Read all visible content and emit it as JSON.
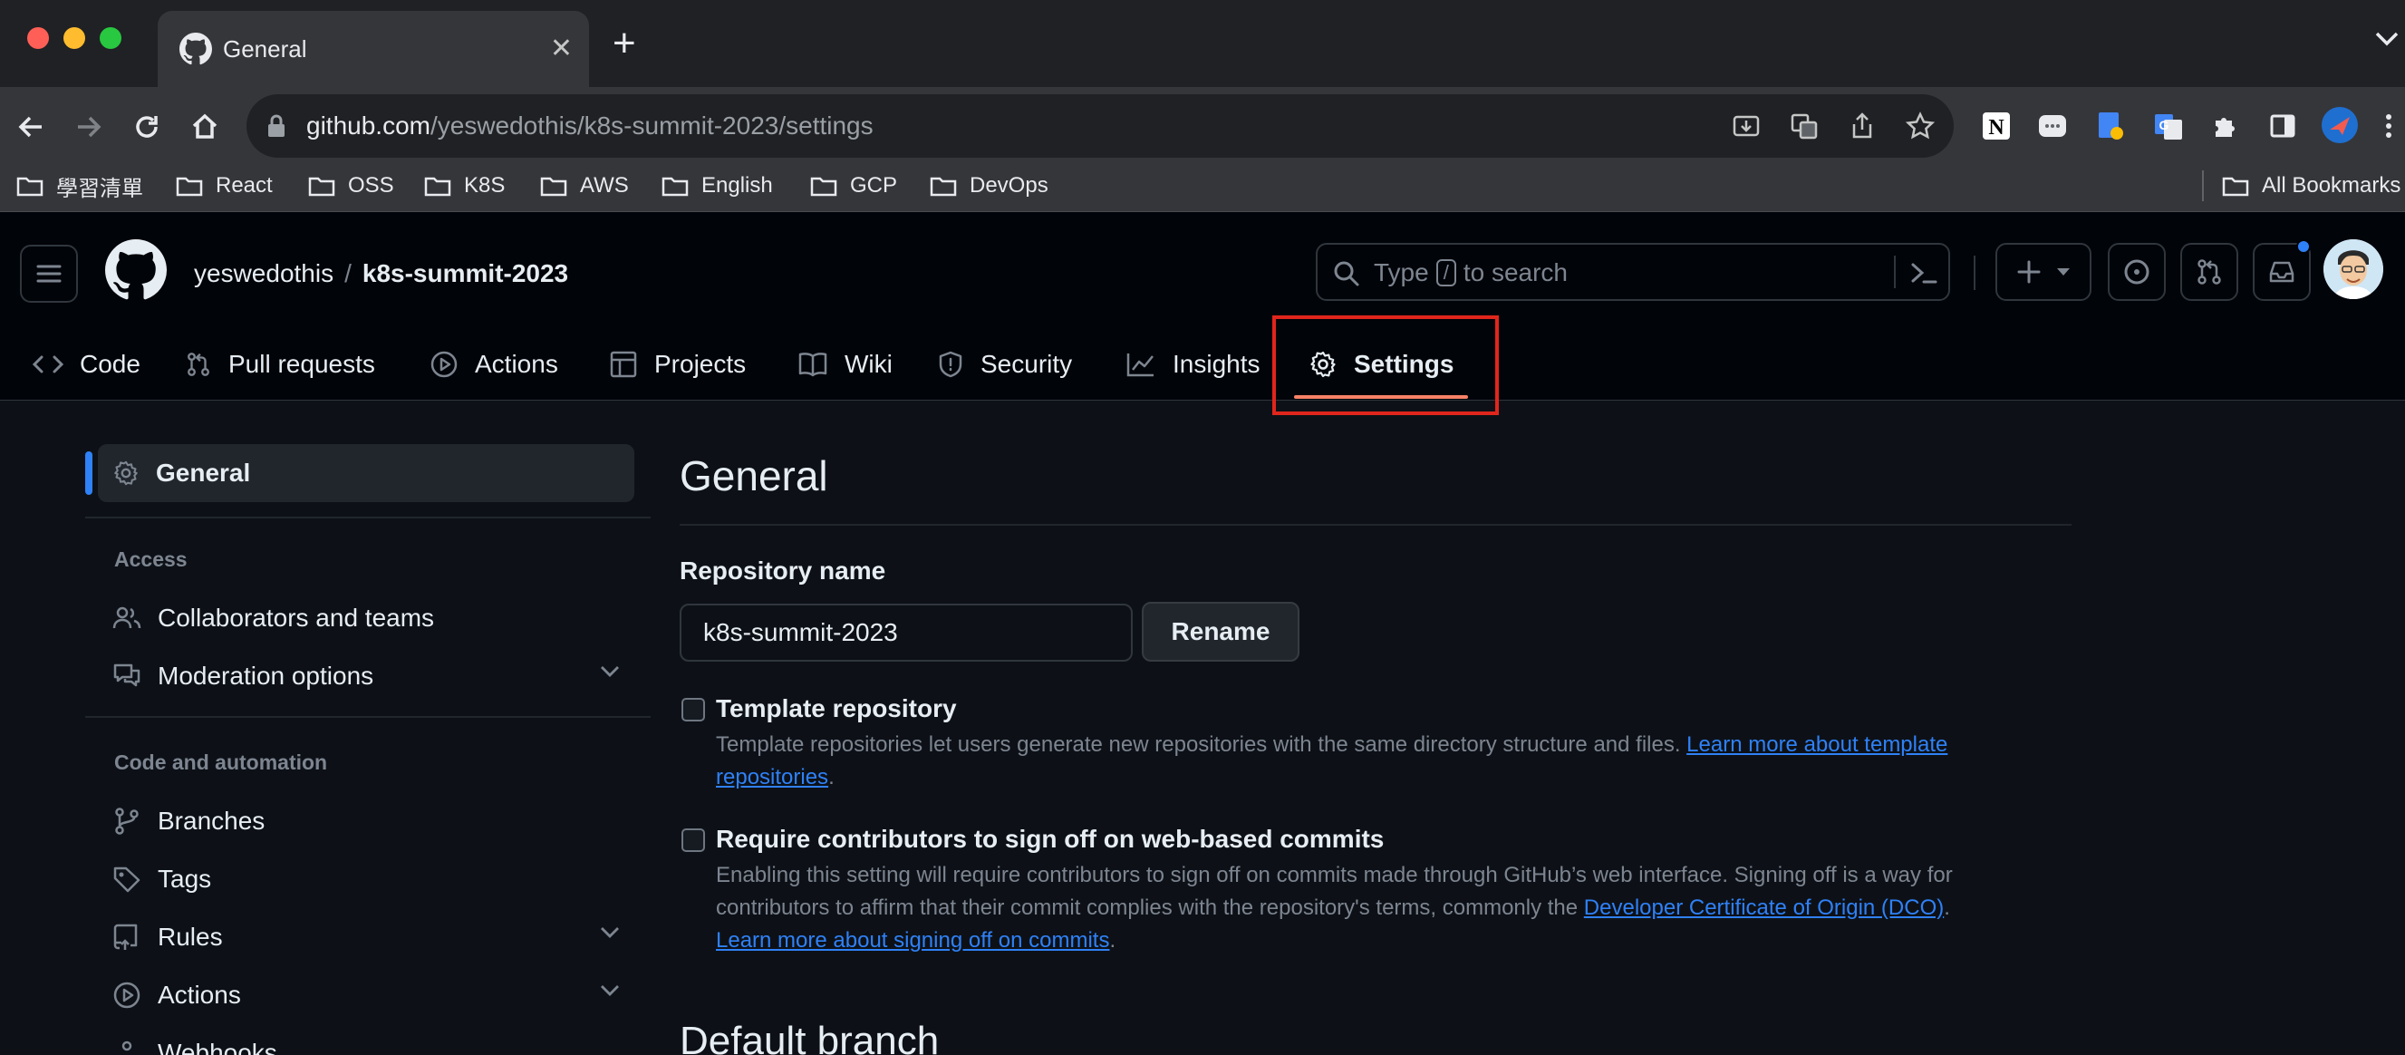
{
  "browser": {
    "tab_title": "General",
    "url_host": "github.com",
    "url_path": "/yeswedothis/k8s-summit-2023/settings",
    "bookmarks": [
      "學習清單",
      "React",
      "OSS",
      "K8S",
      "AWS",
      "English",
      "GCP",
      "DevOps"
    ],
    "all_bookmarks": "All Bookmarks"
  },
  "header": {
    "owner": "yeswedothis",
    "separator": "/",
    "repo": "k8s-summit-2023",
    "search_prefix": "Type",
    "search_key": "/",
    "search_suffix": "to search"
  },
  "repo_nav": {
    "tabs": [
      "Code",
      "Pull requests",
      "Actions",
      "Projects",
      "Wiki",
      "Security",
      "Insights",
      "Settings"
    ],
    "active": "Settings"
  },
  "sidebar": {
    "general": "General",
    "access_heading": "Access",
    "collaborators": "Collaborators and teams",
    "moderation": "Moderation options",
    "code_heading": "Code and automation",
    "branches": "Branches",
    "tags": "Tags",
    "rules": "Rules",
    "actions": "Actions",
    "webhooks": "Webhooks"
  },
  "main": {
    "title": "General",
    "repo_name_label": "Repository name",
    "repo_name_value": "k8s-summit-2023",
    "rename_label": "Rename",
    "template": {
      "label": "Template repository",
      "desc": "Template repositories let users generate new repositories with the same directory structure and files. ",
      "link_a": "Learn more about template",
      "link_b": "repositories",
      "trail": "."
    },
    "signoff": {
      "label": "Require contributors to sign off on web-based commits",
      "desc_a": "Enabling this setting will require contributors to sign off on commits made through GitHub’s web interface. Signing off is a way for",
      "desc_b": "contributors to affirm that their commit complies with the repository's terms, commonly the ",
      "link_dco": "Developer Certificate of Origin (DCO)",
      "trail1": ".",
      "link_learn": "Learn more about signing off on commits",
      "trail2": "."
    },
    "default_branch_title": "Default branch"
  },
  "colors": {
    "accent": "#2f81f7",
    "active_tab_underline": "#f78166",
    "highlight_box": "#e0261c"
  }
}
